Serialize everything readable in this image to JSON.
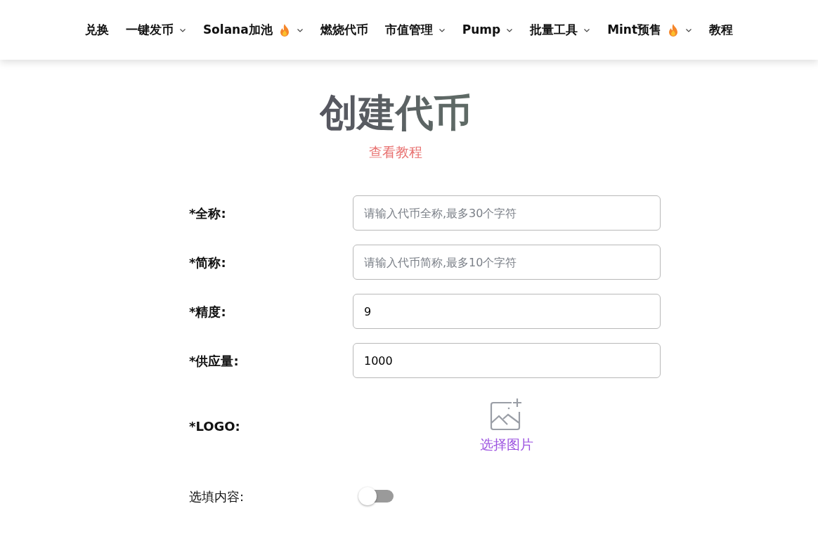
{
  "nav": [
    {
      "label": "兑换",
      "dropdown": false,
      "hot": false
    },
    {
      "label": "一键发币",
      "dropdown": true,
      "hot": false
    },
    {
      "label": "Solana加池",
      "dropdown": true,
      "hot": true
    },
    {
      "label": "燃烧代币",
      "dropdown": false,
      "hot": false
    },
    {
      "label": "市值管理",
      "dropdown": true,
      "hot": false
    },
    {
      "label": "Pump",
      "dropdown": true,
      "hot": false
    },
    {
      "label": "批量工具",
      "dropdown": true,
      "hot": false
    },
    {
      "label": "Mint预售",
      "dropdown": true,
      "hot": true
    },
    {
      "label": "教程",
      "dropdown": false,
      "hot": false
    }
  ],
  "title": "创建代币",
  "tutorial_link": "查看教程",
  "fields": [
    {
      "label": "*全称:",
      "placeholder": "请输入代币全称,最多30个字符"
    },
    {
      "label": "*简称:",
      "placeholder": "请输入代币简称,最多10个字符"
    },
    {
      "label": "*精度:",
      "value": "9"
    },
    {
      "label": "*供应量:",
      "value": "1000"
    }
  ],
  "logo": {
    "label": "*LOGO:",
    "button": "选择图片"
  },
  "optional": {
    "label": "选填内容:",
    "on": false
  }
}
